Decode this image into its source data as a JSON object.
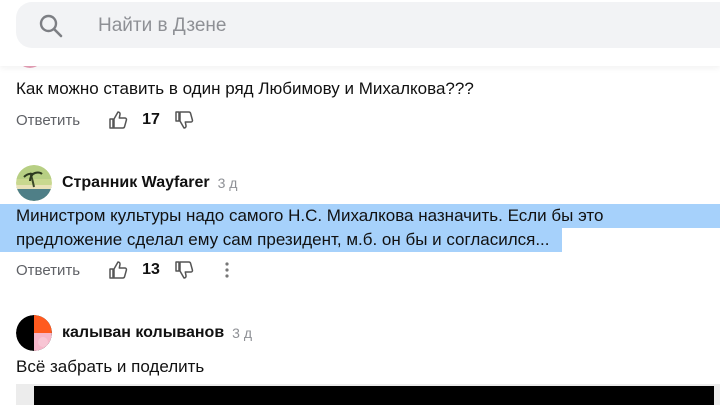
{
  "search": {
    "placeholder": "Найти в Дзене"
  },
  "comments": [
    {
      "text": "Как можно ставить в один ряд Любимову и Михалкова???",
      "reply_label": "Ответить",
      "likes": "17"
    },
    {
      "author": "Странник Wayfarer",
      "time": "3 д",
      "text_line1": "Министром культуры надо самого Н.С. Михалкова назначить. Если бы это",
      "text_line2": "предложение сделал ему сам президент, м.б. он бы и согласился...",
      "reply_label": "Ответить",
      "likes": "13"
    },
    {
      "author": "калыван колыванов",
      "time": "3 д",
      "text": "Всё забрать и поделить"
    }
  ],
  "colors": {
    "selection": "#a6d1fb",
    "search_bg": "#f2f3f5",
    "muted": "#8e9095"
  }
}
